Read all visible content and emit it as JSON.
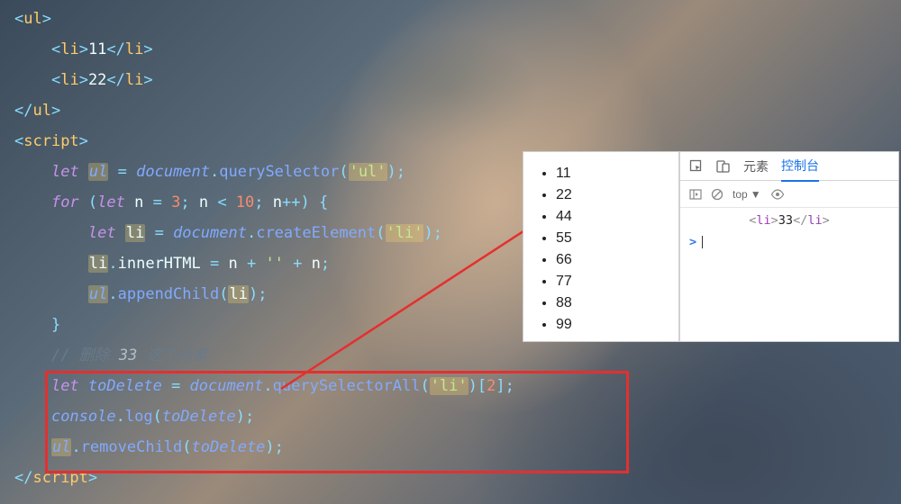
{
  "code": {
    "l0": {
      "p": "",
      "open": "<ul>"
    },
    "l1": {
      "p": "    ",
      "open": "<li>",
      "txt": "11",
      "close": "</li>"
    },
    "l2": {
      "p": "    ",
      "open": "<li>",
      "txt": "22",
      "close": "</li>"
    },
    "l3": {
      "p": "",
      "close": "</ul>"
    },
    "l4": {
      "p": "",
      "open": "<script>"
    },
    "l5": {
      "p": "    ",
      "kw": "let",
      "v": "ul",
      "eq": " = ",
      "obj": "document",
      "dot": ".",
      "fn": "querySelector",
      "lp": "(",
      "s": "'ul'",
      "rp": ")",
      "sc": ";"
    },
    "l6": {
      "p": "    ",
      "kw": "for",
      "lp": " (",
      "kw2": "let",
      "v": "n",
      "eq": " = ",
      "n": "3",
      "sc1": "; ",
      "v2": "n",
      "op": " < ",
      "n2": "10",
      "sc2": "; ",
      "v3": "n",
      "inc": "++",
      "rp": ") {",
      "extra": ""
    },
    "l7": {
      "p": "        ",
      "kw": "let",
      "v": "li",
      "eq": " = ",
      "obj": "document",
      "dot": ".",
      "fn": "createElement",
      "lp": "(",
      "s": "'li'",
      "rp": ")",
      "sc": ";"
    },
    "l8": {
      "p": "        ",
      "obj": "li",
      "dot": ".",
      "prop": "innerHTML",
      "eq": " = ",
      "v": "n",
      "op1": " + ",
      "s": "''",
      "op2": " + ",
      "v2": "n",
      "sc": ";"
    },
    "l9": {
      "p": "        ",
      "obj": "ul",
      "dot": ".",
      "fn": "appendChild",
      "lp": "(",
      "arg": "li",
      "rp": ")",
      "sc": ";"
    },
    "l10": {
      "p": "    ",
      "brace": "}"
    },
    "l11": {
      "p": "    ",
      "cm": "// 删除 ",
      "cmHL": "33",
      "cm2": " 这个元素"
    },
    "l12": {
      "p": "    ",
      "kw": "let",
      "v": "toDelete",
      "eq": " = ",
      "obj": "document",
      "dot": ".",
      "fn": "querySelectorAll",
      "lp": "(",
      "s": "'li'",
      "rp": ")[",
      "n": "2",
      "rb": "]",
      "sc": ";"
    },
    "l13": {
      "p": "    ",
      "obj": "console",
      "dot": ".",
      "fn": "log",
      "lp": "(",
      "arg": "toDelete",
      "rp": ")",
      "sc": ";"
    },
    "l14": {
      "p": "    ",
      "obj": "ul",
      "dot": ".",
      "fn": "removeChild",
      "lp": "(",
      "arg": "toDelete",
      "rp": ")",
      "sc": ";"
    },
    "l15": {
      "p": "",
      "close": "</",
      "tag": "script",
      "end": ">"
    }
  },
  "browser_list": [
    "11",
    "22",
    "44",
    "55",
    "66",
    "77",
    "88",
    "99"
  ],
  "devtools": {
    "tabs": {
      "elements": "元素",
      "console": "控制台"
    },
    "context": "top",
    "log": {
      "open": "<li>",
      "txt": "33",
      "close": "</li>"
    },
    "prompt": ">"
  }
}
